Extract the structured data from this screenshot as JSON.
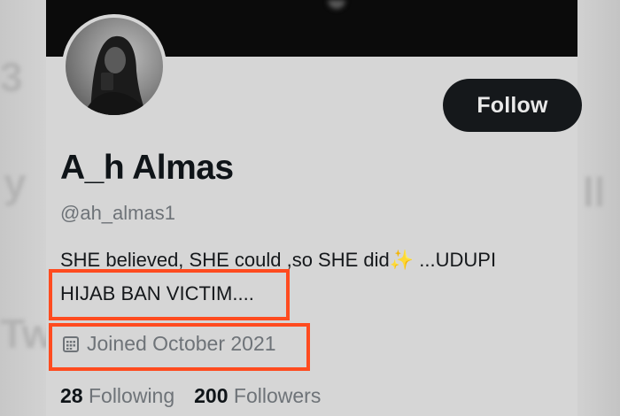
{
  "profile": {
    "name": "A_h Almas",
    "handle": "@ah_almas1",
    "bio_line1": "SHE believed, SHE could ,so SHE did",
    "bio_emoji": "✨",
    "bio_line1_tail": " ...UDUPI",
    "bio_line2": "HIJAB BAN VICTIM....",
    "joined": "Joined October 2021"
  },
  "actions": {
    "follow_label": "Follow"
  },
  "stats": {
    "following_count": "28",
    "following_label": "Following",
    "followers_count": "200",
    "followers_label": "Followers"
  },
  "icons": {
    "calendar": "calendar-icon",
    "sparkles": "sparkles-emoji"
  },
  "colors": {
    "highlight": "#ff4b1f",
    "button_bg": "#15181b",
    "banner": "#0b0b0b"
  }
}
